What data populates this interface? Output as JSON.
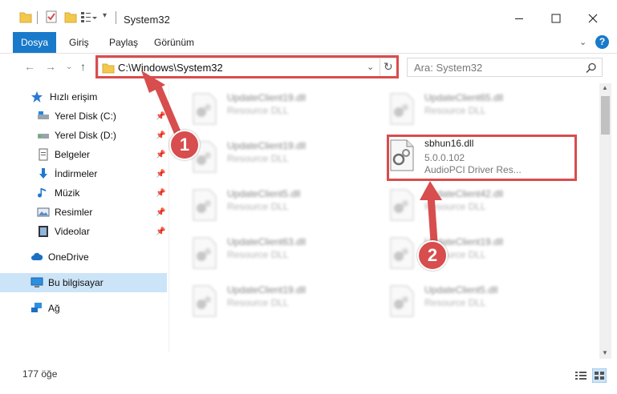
{
  "window": {
    "title": "System32"
  },
  "ribbon": {
    "tabs": [
      "Dosya",
      "Giriş",
      "Paylaş",
      "Görünüm"
    ]
  },
  "nav": {
    "address": "C:\\Windows\\System32",
    "search_placeholder": "Ara: System32"
  },
  "sidebar": {
    "items": [
      {
        "label": "Hızlı erişim"
      },
      {
        "label": "Yerel Disk (C:)"
      },
      {
        "label": "Yerel Disk (D:)"
      },
      {
        "label": "Belgeler"
      },
      {
        "label": "İndirmeler"
      },
      {
        "label": "Müzik"
      },
      {
        "label": "Resimler"
      },
      {
        "label": "Videolar"
      },
      {
        "label": "OneDrive"
      },
      {
        "label": "Bu bilgisayar"
      },
      {
        "label": "Ağ"
      }
    ]
  },
  "files": [
    {
      "name": "UpdateClient19.dll",
      "sub": "Resource DLL"
    },
    {
      "name": "UpdateClient65.dll",
      "sub": "Resource DLL"
    },
    {
      "name": "UpdateClient19.dll",
      "sub": "Resource DLL"
    },
    {
      "name": "sbhun16.dll",
      "sub": "5.0.0.102",
      "sub2": "AudioPCI Driver Res..."
    },
    {
      "name": "UpdateClient5.dll",
      "sub": "Resource DLL"
    },
    {
      "name": "UpdateClient42.dll",
      "sub": "Resource DLL"
    },
    {
      "name": "UpdateClient63.dll",
      "sub": "Resource DLL"
    },
    {
      "name": "UpdateClient19.dll",
      "sub": "Resource DLL"
    },
    {
      "name": "UpdateClient19.dll",
      "sub": "Resource DLL"
    },
    {
      "name": "UpdateClient5.dll",
      "sub": "Resource DLL"
    }
  ],
  "status": {
    "count": "177 öğe"
  },
  "annotations": {
    "step1": "1",
    "step2": "2"
  },
  "colors": {
    "accent": "#1979ca",
    "highlight": "#d84d4d"
  }
}
